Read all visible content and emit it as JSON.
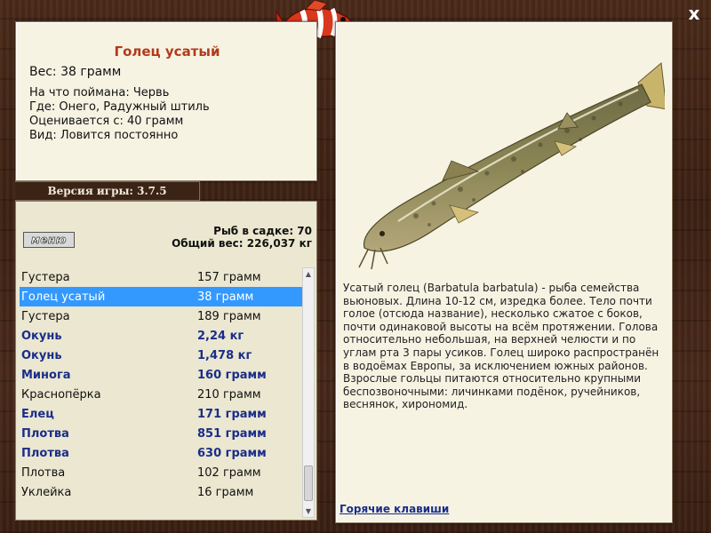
{
  "window": {
    "close_glyph": "x",
    "header_icon": "striped-fish-icon"
  },
  "info": {
    "title": "Голец усатый",
    "weight": "Вес: 38 грамм",
    "caught_with": "На что поймана: Червь",
    "location": "Где: Онего, Радужный штиль",
    "valued_from": "Оценивается с: 40 грамм",
    "kind": "Вид: Ловится постоянно"
  },
  "version": "Версия игры: 3.7.5",
  "menu_button": "меню",
  "stats": {
    "fish_count": "Рыб в садке: 70",
    "total_weight": "Общий вес: 226,037 кг"
  },
  "fish_list": [
    {
      "name": "Густера",
      "weight": "157 грамм",
      "trophy": false,
      "selected": false
    },
    {
      "name": "Голец усатый",
      "weight": "38 грамм",
      "trophy": false,
      "selected": true
    },
    {
      "name": "Густера",
      "weight": "189 грамм",
      "trophy": false,
      "selected": false
    },
    {
      "name": "Окунь",
      "weight": "2,24 кг",
      "trophy": true,
      "selected": false
    },
    {
      "name": "Окунь",
      "weight": "1,478 кг",
      "trophy": true,
      "selected": false
    },
    {
      "name": "Минога",
      "weight": "160 грамм",
      "trophy": true,
      "selected": false
    },
    {
      "name": "Краснопёрка",
      "weight": "210 грамм",
      "trophy": false,
      "selected": false
    },
    {
      "name": "Елец",
      "weight": "171 грамм",
      "trophy": true,
      "selected": false
    },
    {
      "name": "Плотва",
      "weight": "851 грамм",
      "trophy": true,
      "selected": false
    },
    {
      "name": "Плотва",
      "weight": "630 грамм",
      "trophy": true,
      "selected": false
    },
    {
      "name": "Плотва",
      "weight": "102 грамм",
      "trophy": false,
      "selected": false
    },
    {
      "name": "Уклейка",
      "weight": "16 грамм",
      "trophy": false,
      "selected": false
    }
  ],
  "description": "Усатый голец (Barbatula barbatula) - рыба семейства вьюновых. Длина 10-12 см, изредка более. Тело почти голое (отсюда название), несколько сжатое с боков, почти одинаковой высоты на всём протяжении. Голова относительно небольшая, на верхней челюсти и по углам рта 3 пары усиков. Голец широко распространён в водоёмах Европы, за исключением южных районов. Взрослые гольцы питаются относительно крупными беспозвоночными: личинками подёнок, ручейников, веснянок, хирономид.",
  "hotkeys_link": "Горячие клавиши",
  "colors": {
    "title": "#b23a1a",
    "trophy": "#1a2d8a",
    "selection": "#3399ff",
    "panel": "#f6f3e3"
  }
}
